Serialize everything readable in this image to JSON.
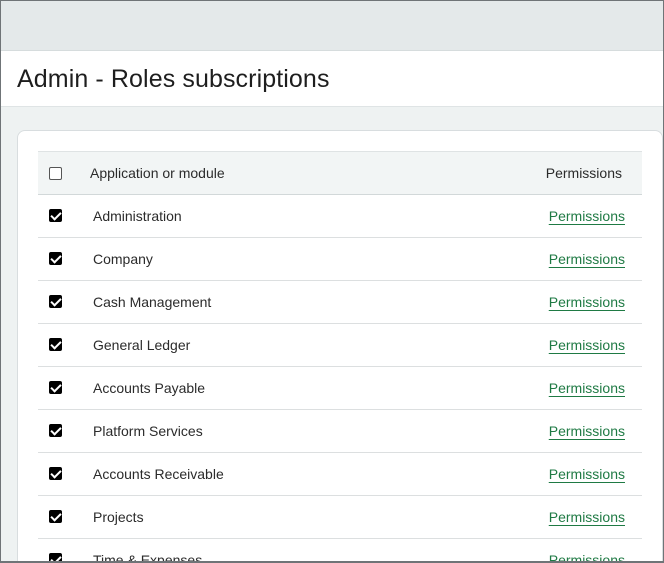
{
  "page": {
    "title": "Admin - Roles subscriptions"
  },
  "table": {
    "columns": {
      "module": "Application or module",
      "permissions": "Permissions"
    },
    "rows": [
      {
        "name": "Administration",
        "link": "Permissions",
        "checked": true
      },
      {
        "name": "Company",
        "link": "Permissions",
        "checked": true
      },
      {
        "name": "Cash Management",
        "link": "Permissions",
        "checked": true
      },
      {
        "name": "General Ledger",
        "link": "Permissions",
        "checked": true
      },
      {
        "name": "Accounts Payable",
        "link": "Permissions",
        "checked": true
      },
      {
        "name": "Platform Services",
        "link": "Permissions",
        "checked": true
      },
      {
        "name": "Accounts Receivable",
        "link": "Permissions",
        "checked": true
      },
      {
        "name": "Projects",
        "link": "Permissions",
        "checked": true
      },
      {
        "name": "Time & Expenses",
        "link": "Permissions",
        "checked": true
      }
    ]
  },
  "colors": {
    "link": "#1f7a44",
    "header_bg": "#f2f5f5"
  }
}
